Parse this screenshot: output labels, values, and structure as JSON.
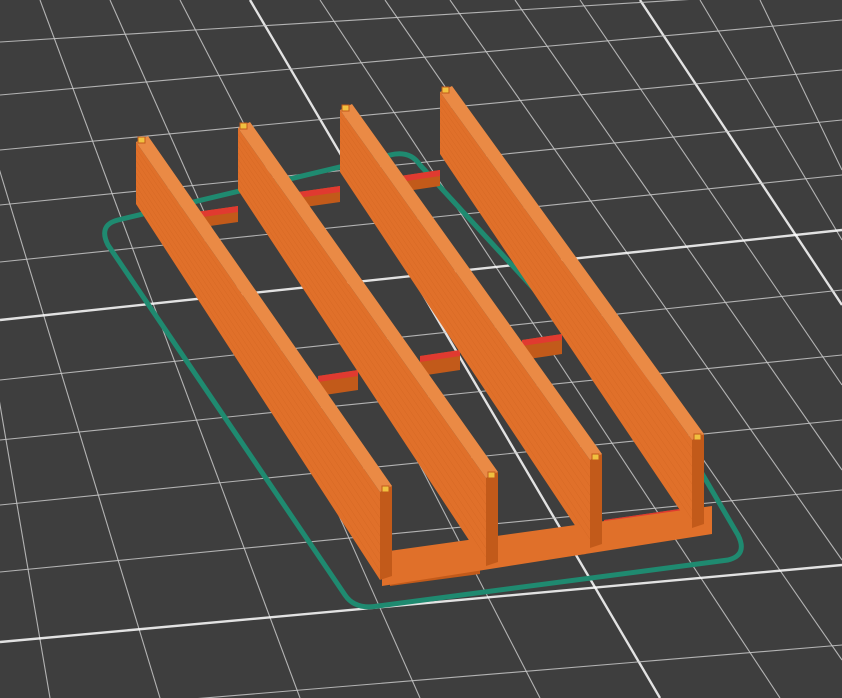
{
  "viewport": {
    "background_color": "#3e3e3e"
  },
  "build_plate": {
    "grid_color": "#c8c8c8",
    "major_grid_color": "#ffffff"
  },
  "model": {
    "wall_color": "#e0702a",
    "wall_dark_color": "#c25a1a",
    "bridge_color": "#e03a30",
    "top_dot_color": "#f0c040",
    "wall_count": 4,
    "bay_count": 3
  },
  "skirt": {
    "color": "#1f8a70"
  }
}
